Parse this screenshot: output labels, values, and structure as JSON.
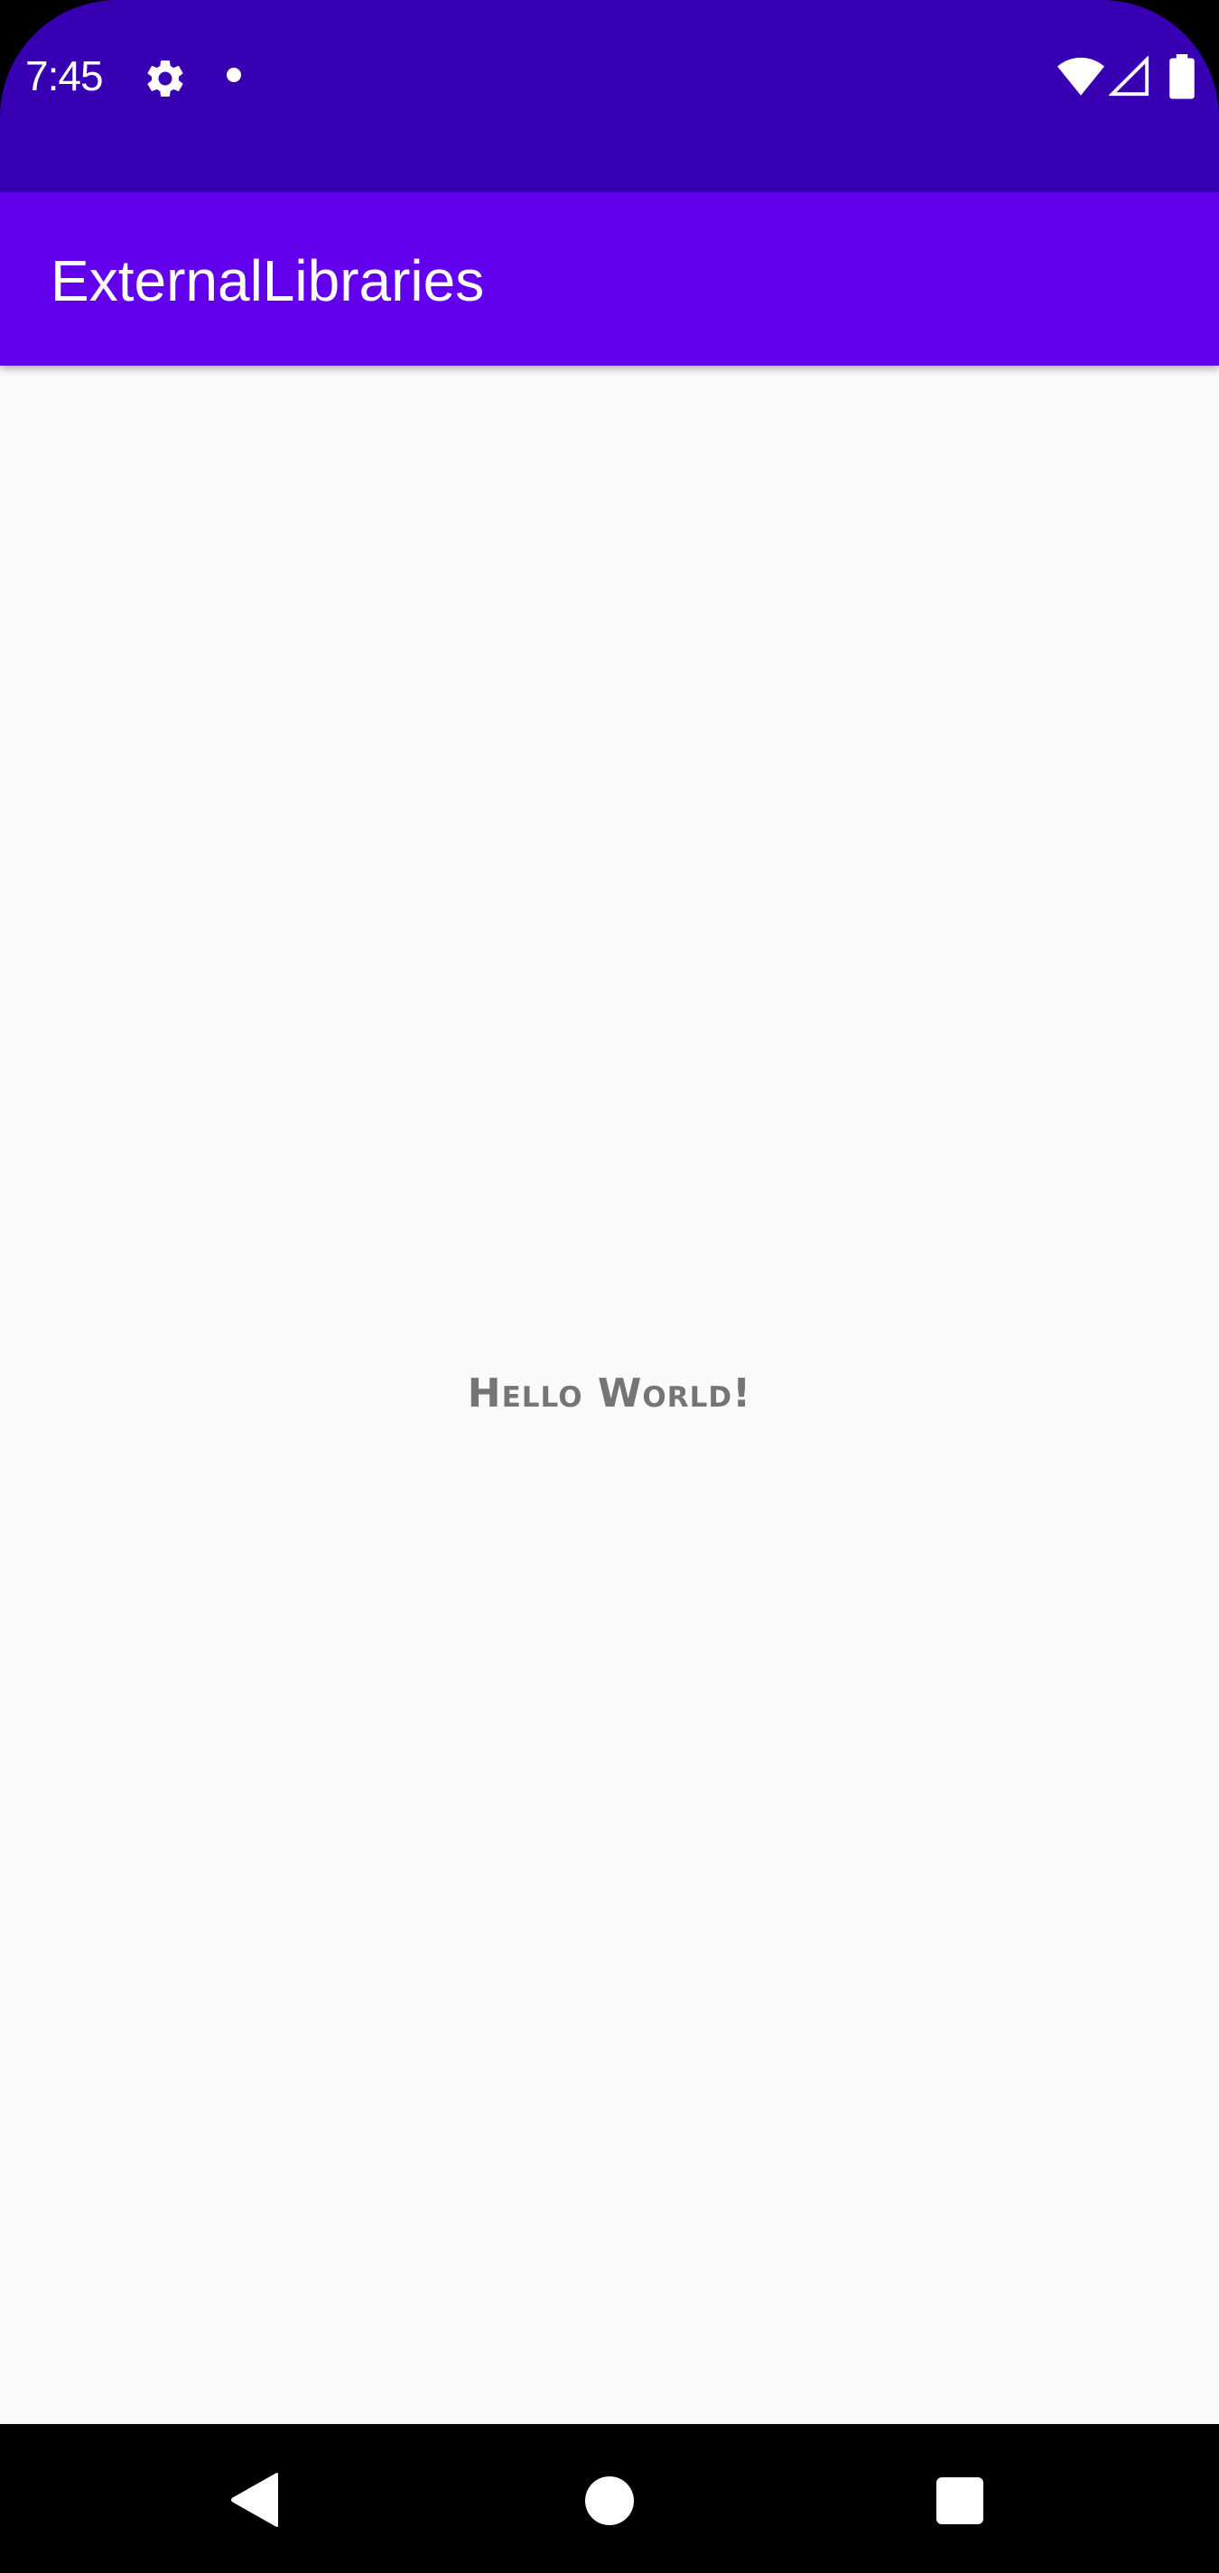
{
  "status_bar": {
    "time": "7:45",
    "icons": [
      "gear-icon",
      "notification-dot-icon",
      "wifi-icon",
      "cell-signal-icon",
      "battery-icon"
    ],
    "background_color": "#3700b3"
  },
  "app_bar": {
    "title": "ExternalLibraries",
    "background_color": "#6200ee"
  },
  "content": {
    "message": "Hello World!",
    "background_color": "#fafafa"
  },
  "nav_bar": {
    "buttons": [
      "back-icon",
      "home-icon",
      "recents-icon"
    ]
  }
}
